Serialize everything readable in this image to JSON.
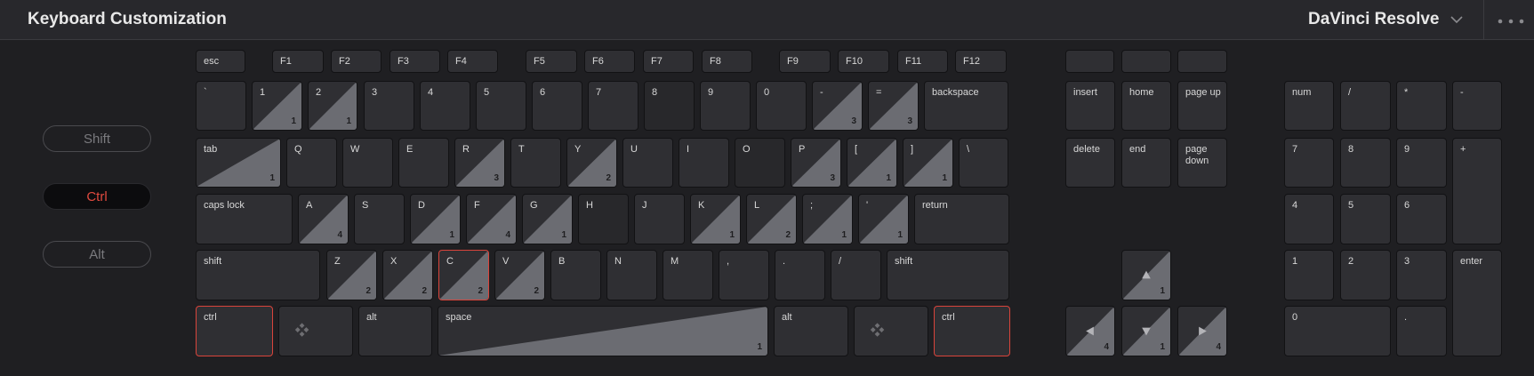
{
  "header": {
    "title": "Keyboard Customization",
    "app_selector": "DaVinci Resolve"
  },
  "modifiers": {
    "shift": "Shift",
    "ctrl": "Ctrl",
    "alt": "Alt",
    "active": "ctrl"
  },
  "colors": {
    "background": "#1f1f22",
    "key": "#2f2f33",
    "assigned_fill": "#6b6c72",
    "selected_border": "#d9443b",
    "active_modifier_text": "#e04a3f"
  },
  "keys": {
    "esc": "esc",
    "f1": "F1",
    "f2": "F2",
    "f3": "F3",
    "f4": "F4",
    "f5": "F5",
    "f6": "F6",
    "f7": "F7",
    "f8": "F8",
    "f9": "F9",
    "f10": "F10",
    "f11": "F11",
    "f12": "F12",
    "backtick": "`",
    "n1": "1",
    "n2": "2",
    "n3": "3",
    "n4": "4",
    "n5": "5",
    "n6": "6",
    "n7": "7",
    "n8": "8",
    "n9": "9",
    "n0": "0",
    "minus": "-",
    "equal": "=",
    "backspace": "backspace",
    "tab": "tab",
    "q": "Q",
    "w": "W",
    "e": "E",
    "r": "R",
    "t": "T",
    "y": "Y",
    "u": "U",
    "i": "I",
    "o": "O",
    "p": "P",
    "lbracket": "[",
    "rbracket": "]",
    "backslash": "\\",
    "caps": "caps lock",
    "a": "A",
    "s": "S",
    "d": "D",
    "f": "F",
    "g": "G",
    "h": "H",
    "j": "J",
    "k": "K",
    "l": "L",
    "semicolon": ";",
    "quote": "'",
    "return": "return",
    "lshift": "shift",
    "z": "Z",
    "x": "X",
    "c": "C",
    "v": "V",
    "b": "B",
    "n": "N",
    "m": "M",
    "comma": ",",
    "period": ".",
    "slash": "/",
    "rshift": "shift",
    "lctrl": "ctrl",
    "lalt": "alt",
    "space": "space",
    "ralt": "alt",
    "rctrl": "ctrl",
    "insert": "insert",
    "home": "home",
    "pageup": "page up",
    "delete": "delete",
    "end": "end",
    "pagedown": "page\ndown",
    "num": "num",
    "kp_div": "/",
    "kp_mul": "*",
    "kp_minus": "-",
    "kp7": "7",
    "kp8": "8",
    "kp9": "9",
    "kp_plus": "+",
    "kp4": "4",
    "kp5": "5",
    "kp6": "6",
    "kp1": "1",
    "kp2": "2",
    "kp3": "3",
    "kp_enter": "enter",
    "kp0": "0",
    "kp_dot": "."
  },
  "assigned_counts": {
    "n1": "1",
    "n2": "1",
    "minus": "3",
    "equal": "3",
    "tab": "1",
    "r": "3",
    "y": "2",
    "p": "3",
    "lbracket": "1",
    "rbracket": "1",
    "a": "4",
    "d": "1",
    "f": "4",
    "g": "1",
    "k": "1",
    "l": "2",
    "semicolon": "1",
    "quote": "1",
    "z": "2",
    "x": "2",
    "c": "2",
    "v": "2",
    "space": "1",
    "up": "1",
    "left": "4",
    "down": "1",
    "right": "4"
  },
  "selected_keys": [
    "c",
    "lctrl",
    "rctrl"
  ]
}
